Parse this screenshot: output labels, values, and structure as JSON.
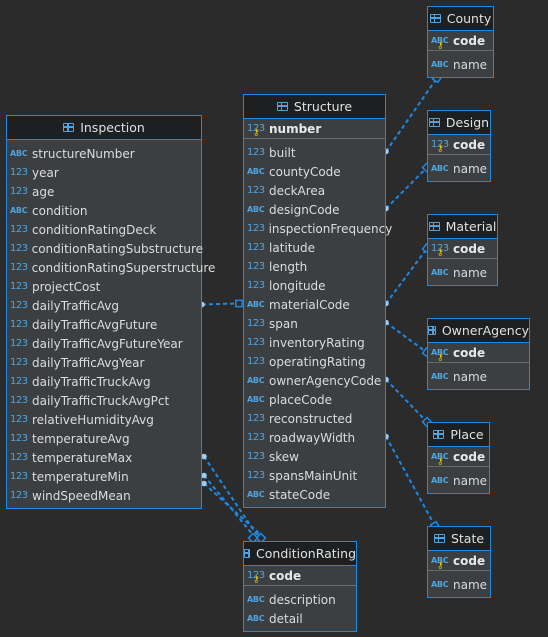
{
  "icons": {
    "text_type": "abc-type-icon",
    "number_type": "number-type-icon",
    "primary_key": "key-icon",
    "table": "table-icon"
  },
  "type_labels": {
    "text": "ABC",
    "number": "123"
  },
  "colors": {
    "background": "#2b2b2b",
    "entity_fill": "#3c3f41",
    "entity_border": "#1e88e5",
    "header_fill": "#1d1f21",
    "link": "#1e88e5"
  },
  "entities": [
    {
      "id": "inspection",
      "title": "Inspection",
      "pk": [],
      "fields": [
        {
          "name": "structureNumber",
          "type": "text"
        },
        {
          "name": "year",
          "type": "number"
        },
        {
          "name": "age",
          "type": "number"
        },
        {
          "name": "condition",
          "type": "text"
        },
        {
          "name": "conditionRatingDeck",
          "type": "number"
        },
        {
          "name": "conditionRatingSubstructure",
          "type": "number"
        },
        {
          "name": "conditionRatingSuperstructure",
          "type": "number"
        },
        {
          "name": "projectCost",
          "type": "number"
        },
        {
          "name": "dailyTrafficAvg",
          "type": "number"
        },
        {
          "name": "dailyTrafficAvgFuture",
          "type": "number"
        },
        {
          "name": "dailyTrafficAvgFutureYear",
          "type": "number"
        },
        {
          "name": "dailyTrafficAvgYear",
          "type": "number"
        },
        {
          "name": "dailyTrafficTruckAvg",
          "type": "number"
        },
        {
          "name": "dailyTrafficTruckAvgPct",
          "type": "number"
        },
        {
          "name": "relativeHumidityAvg",
          "type": "number"
        },
        {
          "name": "temperatureAvg",
          "type": "number"
        },
        {
          "name": "temperatureMax",
          "type": "number"
        },
        {
          "name": "temperatureMin",
          "type": "number"
        },
        {
          "name": "windSpeedMean",
          "type": "number"
        }
      ]
    },
    {
      "id": "structure",
      "title": "Structure",
      "pk": [
        {
          "name": "number",
          "type": "number"
        }
      ],
      "fields": [
        {
          "name": "built",
          "type": "number"
        },
        {
          "name": "countyCode",
          "type": "text"
        },
        {
          "name": "deckArea",
          "type": "number"
        },
        {
          "name": "designCode",
          "type": "text"
        },
        {
          "name": "inspectionFrequency",
          "type": "number"
        },
        {
          "name": "latitude",
          "type": "number"
        },
        {
          "name": "length",
          "type": "number"
        },
        {
          "name": "longitude",
          "type": "number"
        },
        {
          "name": "materialCode",
          "type": "text"
        },
        {
          "name": "span",
          "type": "number"
        },
        {
          "name": "inventoryRating",
          "type": "number"
        },
        {
          "name": "operatingRating",
          "type": "number"
        },
        {
          "name": "ownerAgencyCode",
          "type": "text"
        },
        {
          "name": "placeCode",
          "type": "text"
        },
        {
          "name": "reconstructed",
          "type": "number"
        },
        {
          "name": "roadwayWidth",
          "type": "number"
        },
        {
          "name": "skew",
          "type": "number"
        },
        {
          "name": "spansMainUnit",
          "type": "number"
        },
        {
          "name": "stateCode",
          "type": "text"
        }
      ]
    },
    {
      "id": "county",
      "title": "County",
      "pk": [
        {
          "name": "code",
          "type": "text"
        }
      ],
      "fields": [
        {
          "name": "name",
          "type": "text"
        }
      ]
    },
    {
      "id": "design",
      "title": "Design",
      "pk": [
        {
          "name": "code",
          "type": "number"
        }
      ],
      "fields": [
        {
          "name": "name",
          "type": "text"
        }
      ]
    },
    {
      "id": "material",
      "title": "Material",
      "pk": [
        {
          "name": "code",
          "type": "number"
        }
      ],
      "fields": [
        {
          "name": "name",
          "type": "text"
        }
      ]
    },
    {
      "id": "owneragency",
      "title": "OwnerAgency",
      "pk": [
        {
          "name": "code",
          "type": "text"
        }
      ],
      "fields": [
        {
          "name": "name",
          "type": "text"
        }
      ]
    },
    {
      "id": "place",
      "title": "Place",
      "pk": [
        {
          "name": "code",
          "type": "text"
        }
      ],
      "fields": [
        {
          "name": "name",
          "type": "text"
        }
      ]
    },
    {
      "id": "state",
      "title": "State",
      "pk": [
        {
          "name": "code",
          "type": "text"
        }
      ],
      "fields": [
        {
          "name": "name",
          "type": "text"
        }
      ]
    },
    {
      "id": "conditionrating",
      "title": "ConditionRating",
      "pk": [
        {
          "name": "code",
          "type": "number"
        }
      ],
      "fields": [
        {
          "name": "description",
          "type": "text"
        },
        {
          "name": "detail",
          "type": "text"
        }
      ]
    }
  ],
  "relationships": [
    {
      "from": "inspection",
      "from_field": "dailyTrafficAvg",
      "to": "structure",
      "to_field": "materialCode"
    },
    {
      "from": "structure",
      "from_field": "built",
      "to": "county",
      "to_field": "name"
    },
    {
      "from": "structure",
      "from_field": "designCode",
      "to": "design",
      "to_field": "name"
    },
    {
      "from": "structure",
      "from_field": "materialCode",
      "to": "material",
      "to_field": "code"
    },
    {
      "from": "structure",
      "from_field": "span",
      "to": "owneragency",
      "to_field": "code"
    },
    {
      "from": "structure",
      "from_field": "ownerAgencyCode",
      "to": "place",
      "to_field": "code"
    },
    {
      "from": "structure",
      "from_field": "roadwayWidth",
      "to": "state",
      "to_field": "name"
    },
    {
      "from": "inspection",
      "from_field": "temperatureMax",
      "to": "conditionrating",
      "to_field": "code"
    },
    {
      "from": "inspection",
      "from_field": "temperatureMin",
      "to": "conditionrating",
      "to_field": "code"
    },
    {
      "from": "inspection",
      "from_field": "temperatureMin",
      "to": "conditionrating",
      "to_field": "code"
    }
  ]
}
